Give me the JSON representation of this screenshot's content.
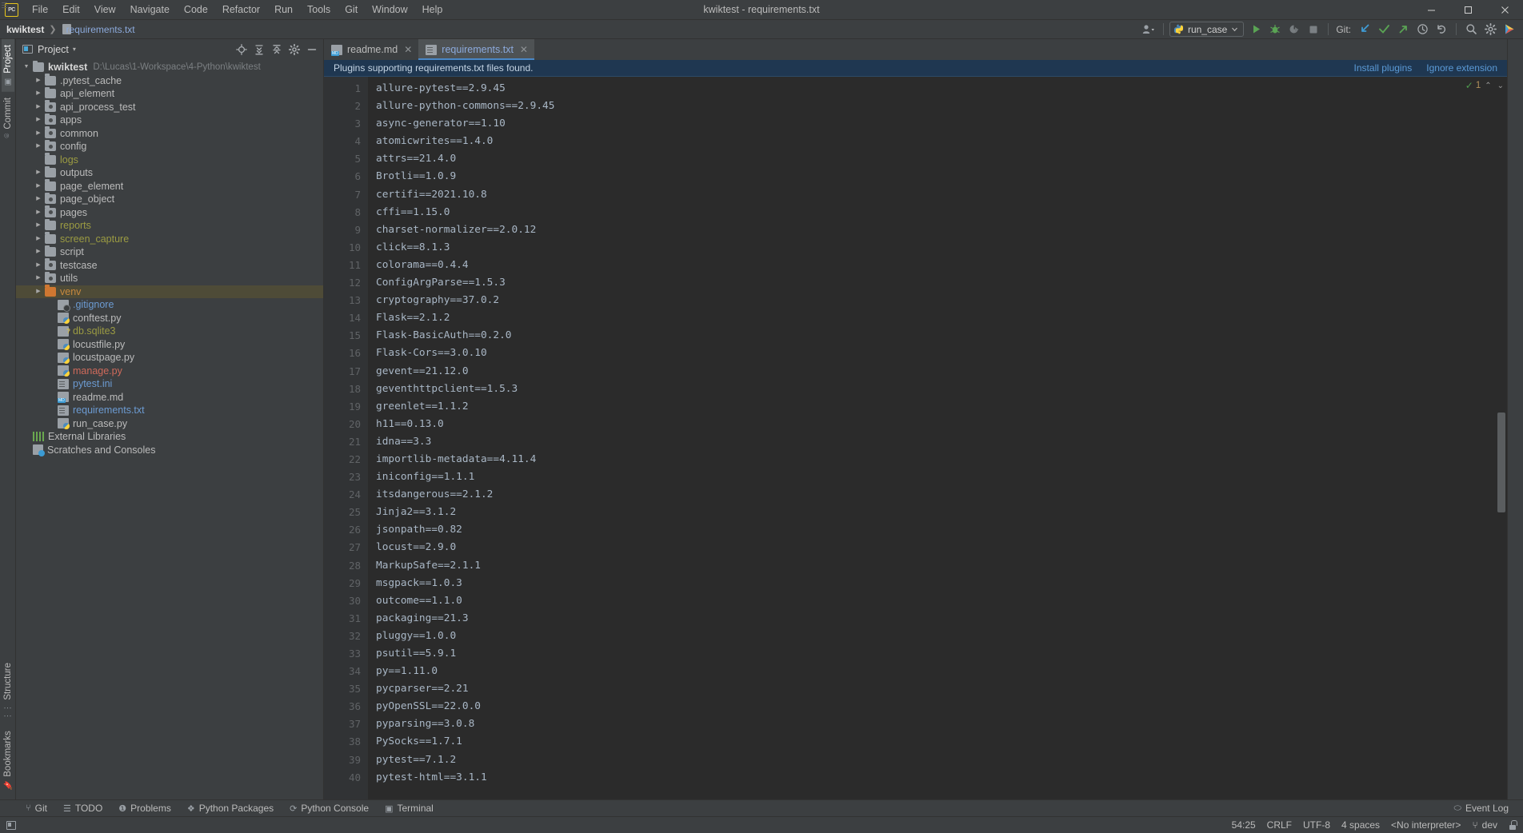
{
  "window": {
    "title": "kwiktest - requirements.txt",
    "logo_text": "PC",
    "minimize": "—",
    "maximize": "□",
    "close": "✕"
  },
  "menu": [
    {
      "label": "File"
    },
    {
      "label": "Edit"
    },
    {
      "label": "View"
    },
    {
      "label": "Navigate"
    },
    {
      "label": "Code"
    },
    {
      "label": "Refactor"
    },
    {
      "label": "Run"
    },
    {
      "label": "Tools"
    },
    {
      "label": "Git"
    },
    {
      "label": "Window"
    },
    {
      "label": "Help"
    }
  ],
  "navbar": {
    "breadcrumbs": [
      {
        "label": "kwiktest",
        "type": "project"
      },
      {
        "label": "requirements.txt",
        "type": "file"
      }
    ],
    "separator": "❯",
    "run_config": "run_case",
    "git_label": "Git:",
    "icons": {
      "user": "user-avatar-icon",
      "run": "run-icon",
      "debug": "debug-icon",
      "coverage": "run-with-coverage-icon",
      "stop": "stop-icon",
      "update": "git-update-icon",
      "commit": "git-commit-icon",
      "push": "git-push-icon",
      "history": "git-history-icon",
      "rollback": "git-rollback-icon",
      "search": "search-everywhere-icon",
      "settings": "settings-icon",
      "ide": "ide-icon"
    }
  },
  "left_strip": {
    "top": [
      {
        "label": "Project",
        "active": true,
        "icon": "project-icon"
      },
      {
        "label": "Commit",
        "active": false,
        "icon": "commit-icon"
      }
    ],
    "bottom": [
      {
        "label": "Structure",
        "active": false,
        "icon": "structure-icon"
      },
      {
        "label": "Bookmarks",
        "active": false,
        "icon": "bookmarks-icon"
      }
    ]
  },
  "project_panel": {
    "title": "Project",
    "caret": "▾",
    "tools": [
      {
        "name": "select-opened-file-icon",
        "glyph": "⊕"
      },
      {
        "name": "expand-all-icon",
        "glyph": "⤓"
      },
      {
        "name": "collapse-all-icon",
        "glyph": "⤒"
      },
      {
        "name": "settings-gear-icon",
        "glyph": "⚙"
      },
      {
        "name": "hide-panel-icon",
        "glyph": "—"
      }
    ],
    "tree": [
      {
        "label": "kwiktest",
        "path": "D:\\Lucas\\1-Workspace\\4-Python\\kwiktest",
        "indent": 0,
        "arrow": "down",
        "icon": "folder",
        "style": "bold"
      },
      {
        "label": ".pytest_cache",
        "indent": 1,
        "arrow": "right",
        "icon": "folder",
        "style": ""
      },
      {
        "label": "api_element",
        "indent": 1,
        "arrow": "right",
        "icon": "folder",
        "style": ""
      },
      {
        "label": "api_process_test",
        "indent": 1,
        "arrow": "right",
        "icon": "folder-src",
        "style": ""
      },
      {
        "label": "apps",
        "indent": 1,
        "arrow": "right",
        "icon": "folder-src",
        "style": ""
      },
      {
        "label": "common",
        "indent": 1,
        "arrow": "right",
        "icon": "folder-src",
        "style": ""
      },
      {
        "label": "config",
        "indent": 1,
        "arrow": "right",
        "icon": "folder-src",
        "style": ""
      },
      {
        "label": "logs",
        "indent": 1,
        "arrow": "",
        "icon": "folder",
        "style": "olive"
      },
      {
        "label": "outputs",
        "indent": 1,
        "arrow": "right",
        "icon": "folder",
        "style": ""
      },
      {
        "label": "page_element",
        "indent": 1,
        "arrow": "right",
        "icon": "folder",
        "style": ""
      },
      {
        "label": "page_object",
        "indent": 1,
        "arrow": "right",
        "icon": "folder-src",
        "style": ""
      },
      {
        "label": "pages",
        "indent": 1,
        "arrow": "right",
        "icon": "folder-src",
        "style": ""
      },
      {
        "label": "reports",
        "indent": 1,
        "arrow": "right",
        "icon": "folder",
        "style": "olive"
      },
      {
        "label": "screen_capture",
        "indent": 1,
        "arrow": "right",
        "icon": "folder",
        "style": "olive"
      },
      {
        "label": "script",
        "indent": 1,
        "arrow": "right",
        "icon": "folder",
        "style": ""
      },
      {
        "label": "testcase",
        "indent": 1,
        "arrow": "right",
        "icon": "folder-src",
        "style": ""
      },
      {
        "label": "utils",
        "indent": 1,
        "arrow": "right",
        "icon": "folder-src",
        "style": ""
      },
      {
        "label": "venv",
        "indent": 1,
        "arrow": "right",
        "icon": "folder-orange",
        "style": "orange",
        "selected": true
      },
      {
        "label": ".gitignore",
        "indent": 2,
        "arrow": "",
        "icon": "gitignore",
        "style": "blue"
      },
      {
        "label": "conftest.py",
        "indent": 2,
        "arrow": "",
        "icon": "py",
        "style": ""
      },
      {
        "label": "db.sqlite3",
        "indent": 2,
        "arrow": "",
        "icon": "sqlite",
        "style": "olive"
      },
      {
        "label": "locustfile.py",
        "indent": 2,
        "arrow": "",
        "icon": "py",
        "style": ""
      },
      {
        "label": "locustpage.py",
        "indent": 2,
        "arrow": "",
        "icon": "py",
        "style": ""
      },
      {
        "label": "manage.py",
        "indent": 2,
        "arrow": "",
        "icon": "py",
        "style": "red"
      },
      {
        "label": "pytest.ini",
        "indent": 2,
        "arrow": "",
        "icon": "file",
        "style": "blue"
      },
      {
        "label": "readme.md",
        "indent": 2,
        "arrow": "",
        "icon": "md",
        "style": ""
      },
      {
        "label": "requirements.txt",
        "indent": 2,
        "arrow": "",
        "icon": "file",
        "style": "blue"
      },
      {
        "label": "run_case.py",
        "indent": 2,
        "arrow": "",
        "icon": "py",
        "style": ""
      },
      {
        "label": "External Libraries",
        "indent": 0,
        "arrow": "",
        "icon": "libs",
        "style": ""
      },
      {
        "label": "Scratches and Consoles",
        "indent": 0,
        "arrow": "",
        "icon": "scratch",
        "style": ""
      }
    ]
  },
  "editor": {
    "tabs": [
      {
        "label": "readme.md",
        "icon": "md",
        "active": false,
        "close": "✕"
      },
      {
        "label": "requirements.txt",
        "icon": "file",
        "active": true,
        "close": "✕"
      }
    ],
    "notification": {
      "message": "Plugins supporting requirements.txt files found.",
      "actions": [
        {
          "label": "Install plugins"
        },
        {
          "label": "Ignore extension"
        }
      ]
    },
    "inspection": {
      "check": "✓",
      "count": "1",
      "up": "⌃",
      "down": "⌄"
    },
    "lines": [
      "allure-pytest==2.9.45",
      "allure-python-commons==2.9.45",
      "async-generator==1.10",
      "atomicwrites==1.4.0",
      "attrs==21.4.0",
      "Brotli==1.0.9",
      "certifi==2021.10.8",
      "cffi==1.15.0",
      "charset-normalizer==2.0.12",
      "click==8.1.3",
      "colorama==0.4.4",
      "ConfigArgParse==1.5.3",
      "cryptography==37.0.2",
      "Flask==2.1.2",
      "Flask-BasicAuth==0.2.0",
      "Flask-Cors==3.0.10",
      "gevent==21.12.0",
      "geventhttpclient==1.5.3",
      "greenlet==1.1.2",
      "h11==0.13.0",
      "idna==3.3",
      "importlib-metadata==4.11.4",
      "iniconfig==1.1.1",
      "itsdangerous==2.1.2",
      "Jinja2==3.1.2",
      "jsonpath==0.82",
      "locust==2.9.0",
      "MarkupSafe==2.1.1",
      "msgpack==1.0.3",
      "outcome==1.1.0",
      "packaging==21.3",
      "pluggy==1.0.0",
      "psutil==5.9.1",
      "py==1.11.0",
      "pycparser==2.21",
      "pyOpenSSL==22.0.0",
      "pyparsing==3.0.8",
      "PySocks==1.7.1",
      "pytest==7.1.2",
      "pytest-html==3.1.1"
    ]
  },
  "tool_windows": [
    {
      "label": "Git",
      "icon": "git-branch-icon"
    },
    {
      "label": "TODO",
      "icon": "todo-list-icon"
    },
    {
      "label": "Problems",
      "icon": "problems-icon"
    },
    {
      "label": "Python Packages",
      "icon": "packages-icon"
    },
    {
      "label": "Python Console",
      "icon": "python-console-icon"
    },
    {
      "label": "Terminal",
      "icon": "terminal-icon"
    }
  ],
  "event_log": {
    "label": "Event Log",
    "icon": "event-log-icon"
  },
  "status_bar": {
    "caret_position": "54:25",
    "line_separator": "CRLF",
    "encoding": "UTF-8",
    "indent": "4 spaces",
    "interpreter": "<No interpreter>",
    "branch": "dev",
    "branch_icon": "git-branch-icon",
    "lock_icon": "lock-icon"
  },
  "colors": {
    "bg_chrome": "#3c3f41",
    "bg_editor": "#2b2b2b",
    "gutter": "#313335",
    "accent_blue": "#4a88c7",
    "text": "#bbbbbb",
    "code_text": "#a9b7c6",
    "notify_bg": "#1f3751",
    "selection": "#4e4b37",
    "olive": "#9b9b42",
    "orange": "#c8893e",
    "red": "#cf6a5b"
  }
}
